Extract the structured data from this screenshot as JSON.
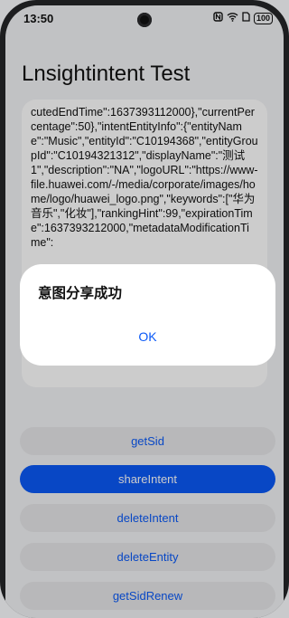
{
  "status": {
    "time": "13:50",
    "battery": "100",
    "icons": [
      "nfc-icon",
      "wifi-icon",
      "sim-icon",
      "battery-icon"
    ]
  },
  "app": {
    "title": "Lnsightintent Test"
  },
  "output": {
    "text": "cutedEndTime\":1637393112000},\"currentPercentage\":50},\"intentEntityInfo\":{\"entityName\":\"Music\",\"entityId\":\"C10194368\",\"entityGroupId\":\"C10194321312\",\"displayName\":\"测试1\",\"description\":\"NA\",\"logoURL\":\"https://www-file.huawei.com/-/media/corporate/images/home/logo/huawei_logo.png\",\"keywords\":[\"华为音乐\",\"化妆\"],\"rankingHint\":99,\"expirationTime\":1637393212000,\"metadataModificationTime\":\n\n\n\n\n后\"],\"isPublicData\":false}}"
  },
  "buttons": {
    "getSid": "getSid",
    "shareIntent": "shareIntent",
    "deleteIntent": "deleteIntent",
    "deleteEntity": "deleteEntity",
    "getSidRenew": "getSidRenew"
  },
  "dialog": {
    "message": "意图分享成功",
    "ok": "OK"
  },
  "colors": {
    "accent": "#0a59f7",
    "background": "#f2f3f5",
    "button_bg": "#e6e7e9"
  }
}
